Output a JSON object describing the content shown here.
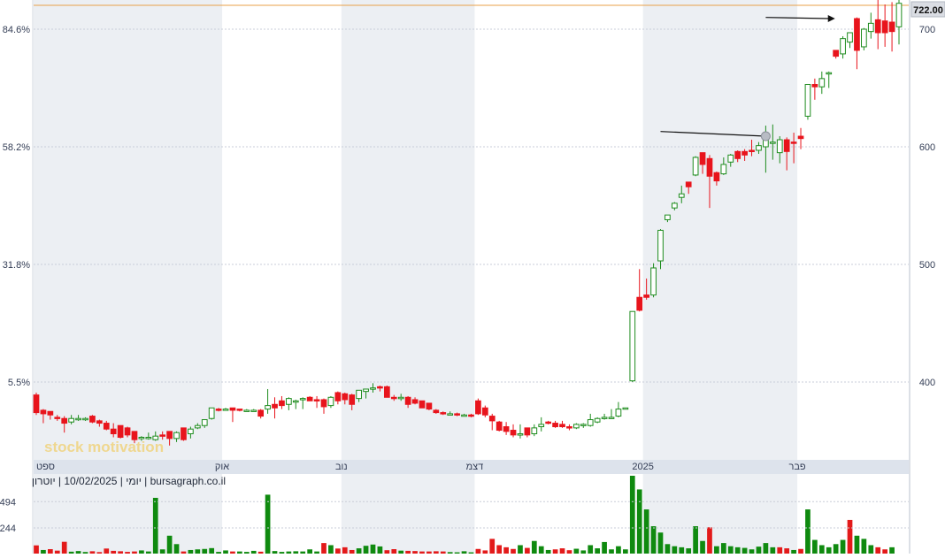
{
  "chart_data": {
    "type": "candlestick",
    "price_axis": {
      "ticks": [
        400,
        500,
        600,
        700
      ],
      "tick_labels": [
        "400",
        "500",
        "600",
        "700"
      ],
      "ylim": [
        326,
        728
      ]
    },
    "percent_axis": {
      "ticks": [
        400,
        500,
        600,
        700
      ],
      "tick_labels": [
        "5.5%",
        "31.8%",
        "58.2%",
        "84.6%"
      ]
    },
    "last_price": {
      "value": 722,
      "label": "722.00"
    },
    "month_labels": [
      {
        "index": 0,
        "label": "ספט"
      },
      {
        "index": 27,
        "label": "אוק"
      },
      {
        "index": 44,
        "label": "נוב"
      },
      {
        "index": 63,
        "label": "דצמ"
      },
      {
        "index": 87,
        "label": "2025"
      },
      {
        "index": 109,
        "label": "פבר"
      }
    ],
    "info_text": "יומי | 10/02/2025 | יוטרון | bursagraph.co.il",
    "watermark": "stock motivation",
    "volume_axis": {
      "ticks": [
        244,
        494
      ],
      "tick_labels": [
        "244",
        "494"
      ],
      "ylim": [
        0,
        740
      ]
    },
    "trendlines": [
      {
        "from": {
          "index": 89,
          "price": 613
        },
        "to": {
          "index": 104,
          "price": 609
        },
        "end_marker": "dot"
      },
      {
        "from": {
          "index": 104,
          "price": 710
        },
        "to": {
          "index": 113,
          "price": 709
        },
        "end_marker": "arrow"
      }
    ],
    "candles": [
      {
        "o": 389,
        "h": 391,
        "l": 372,
        "c": 374
      },
      {
        "o": 376,
        "h": 377,
        "l": 365,
        "c": 373
      },
      {
        "o": 375,
        "h": 375,
        "l": 368,
        "c": 372
      },
      {
        "o": 370,
        "h": 372,
        "l": 367,
        "c": 369
      },
      {
        "o": 369,
        "h": 371,
        "l": 357,
        "c": 365
      },
      {
        "o": 366,
        "h": 372,
        "l": 364,
        "c": 369
      },
      {
        "o": 368,
        "h": 372,
        "l": 367,
        "c": 369
      },
      {
        "o": 369,
        "h": 370,
        "l": 367,
        "c": 369
      },
      {
        "o": 371,
        "h": 372,
        "l": 365,
        "c": 366
      },
      {
        "o": 367,
        "h": 368,
        "l": 362,
        "c": 365
      },
      {
        "o": 365,
        "h": 367,
        "l": 359,
        "c": 360
      },
      {
        "o": 360,
        "h": 365,
        "l": 353,
        "c": 356
      },
      {
        "o": 363,
        "h": 363,
        "l": 352,
        "c": 353
      },
      {
        "o": 361,
        "h": 362,
        "l": 353,
        "c": 355
      },
      {
        "o": 358,
        "h": 358,
        "l": 348,
        "c": 351
      },
      {
        "o": 352,
        "h": 354,
        "l": 350,
        "c": 353
      },
      {
        "o": 353,
        "h": 357,
        "l": 351,
        "c": 353
      },
      {
        "o": 351,
        "h": 358,
        "l": 350,
        "c": 354
      },
      {
        "o": 355,
        "h": 358,
        "l": 351,
        "c": 354
      },
      {
        "o": 358,
        "h": 358,
        "l": 346,
        "c": 352
      },
      {
        "o": 352,
        "h": 358,
        "l": 349,
        "c": 357
      },
      {
        "o": 361,
        "h": 361,
        "l": 350,
        "c": 351
      },
      {
        "o": 356,
        "h": 362,
        "l": 352,
        "c": 360
      },
      {
        "o": 361,
        "h": 365,
        "l": 360,
        "c": 363
      },
      {
        "o": 363,
        "h": 368,
        "l": 361,
        "c": 368
      },
      {
        "o": 369,
        "h": 378,
        "l": 368,
        "c": 378
      },
      {
        "o": 377,
        "h": 378,
        "l": 375,
        "c": 376
      },
      {
        "o": 377,
        "h": 378,
        "l": 376,
        "c": 377
      },
      {
        "o": 378,
        "h": 378,
        "l": 366,
        "c": 376
      },
      {
        "o": 377,
        "h": 377,
        "l": 375,
        "c": 376
      },
      {
        "o": 376,
        "h": 377,
        "l": 375,
        "c": 376
      },
      {
        "o": 376,
        "h": 377,
        "l": 375,
        "c": 376
      },
      {
        "o": 376,
        "h": 377,
        "l": 369,
        "c": 371
      },
      {
        "o": 377,
        "h": 394,
        "l": 373,
        "c": 380
      },
      {
        "o": 381,
        "h": 387,
        "l": 369,
        "c": 378
      },
      {
        "o": 384,
        "h": 388,
        "l": 377,
        "c": 380
      },
      {
        "o": 381,
        "h": 387,
        "l": 376,
        "c": 386
      },
      {
        "o": 383,
        "h": 385,
        "l": 377,
        "c": 384
      },
      {
        "o": 385,
        "h": 387,
        "l": 377,
        "c": 386
      },
      {
        "o": 387,
        "h": 388,
        "l": 384,
        "c": 384
      },
      {
        "o": 385,
        "h": 388,
        "l": 378,
        "c": 384
      },
      {
        "o": 385,
        "h": 386,
        "l": 373,
        "c": 379
      },
      {
        "o": 380,
        "h": 388,
        "l": 378,
        "c": 387
      },
      {
        "o": 391,
        "h": 392,
        "l": 381,
        "c": 384
      },
      {
        "o": 390,
        "h": 391,
        "l": 381,
        "c": 385
      },
      {
        "o": 389,
        "h": 390,
        "l": 376,
        "c": 381
      },
      {
        "o": 386,
        "h": 392,
        "l": 383,
        "c": 393
      },
      {
        "o": 392,
        "h": 393,
        "l": 386,
        "c": 394
      },
      {
        "o": 394,
        "h": 399,
        "l": 391,
        "c": 395
      },
      {
        "o": 396,
        "h": 397,
        "l": 392,
        "c": 395
      },
      {
        "o": 396,
        "h": 397,
        "l": 387,
        "c": 387
      },
      {
        "o": 387,
        "h": 389,
        "l": 384,
        "c": 386
      },
      {
        "o": 387,
        "h": 390,
        "l": 384,
        "c": 387
      },
      {
        "o": 387,
        "h": 388,
        "l": 378,
        "c": 381
      },
      {
        "o": 385,
        "h": 387,
        "l": 381,
        "c": 382
      },
      {
        "o": 384,
        "h": 384,
        "l": 379,
        "c": 378
      },
      {
        "o": 382,
        "h": 382,
        "l": 376,
        "c": 377
      },
      {
        "o": 376,
        "h": 377,
        "l": 373,
        "c": 374
      },
      {
        "o": 374,
        "h": 375,
        "l": 372,
        "c": 373
      },
      {
        "o": 373,
        "h": 375,
        "l": 372,
        "c": 373
      },
      {
        "o": 373,
        "h": 374,
        "l": 371,
        "c": 372
      },
      {
        "o": 372,
        "h": 373,
        "l": 371,
        "c": 372
      },
      {
        "o": 372,
        "h": 373,
        "l": 370,
        "c": 371
      },
      {
        "o": 384,
        "h": 386,
        "l": 372,
        "c": 373
      },
      {
        "o": 378,
        "h": 380,
        "l": 370,
        "c": 372
      },
      {
        "o": 371,
        "h": 373,
        "l": 359,
        "c": 367
      },
      {
        "o": 366,
        "h": 367,
        "l": 358,
        "c": 359
      },
      {
        "o": 362,
        "h": 366,
        "l": 355,
        "c": 358
      },
      {
        "o": 359,
        "h": 364,
        "l": 353,
        "c": 355
      },
      {
        "o": 355,
        "h": 364,
        "l": 352,
        "c": 356
      },
      {
        "o": 361,
        "h": 361,
        "l": 353,
        "c": 355
      },
      {
        "o": 356,
        "h": 364,
        "l": 354,
        "c": 361
      },
      {
        "o": 362,
        "h": 370,
        "l": 358,
        "c": 364
      },
      {
        "o": 366,
        "h": 367,
        "l": 364,
        "c": 365
      },
      {
        "o": 365,
        "h": 367,
        "l": 361,
        "c": 362
      },
      {
        "o": 364,
        "h": 367,
        "l": 361,
        "c": 362
      },
      {
        "o": 362,
        "h": 364,
        "l": 359,
        "c": 361
      },
      {
        "o": 361,
        "h": 365,
        "l": 360,
        "c": 364
      },
      {
        "o": 363,
        "h": 365,
        "l": 361,
        "c": 364
      },
      {
        "o": 363,
        "h": 373,
        "l": 362,
        "c": 368
      },
      {
        "o": 366,
        "h": 370,
        "l": 365,
        "c": 369
      },
      {
        "o": 369,
        "h": 373,
        "l": 368,
        "c": 370
      },
      {
        "o": 370,
        "h": 377,
        "l": 369,
        "c": 370
      },
      {
        "o": 371,
        "h": 383,
        "l": 370,
        "c": 377
      },
      {
        "o": 378,
        "h": 378,
        "l": 377,
        "c": 378
      },
      {
        "o": 401,
        "h": 406,
        "l": 400,
        "c": 460
      },
      {
        "o": 472,
        "h": 496,
        "l": 460,
        "c": 461
      },
      {
        "o": 474,
        "h": 488,
        "l": 470,
        "c": 472
      },
      {
        "o": 474,
        "h": 501,
        "l": 472,
        "c": 497
      },
      {
        "o": 503,
        "h": 530,
        "l": 496,
        "c": 529
      },
      {
        "o": 538,
        "h": 542,
        "l": 536,
        "c": 542
      },
      {
        "o": 548,
        "h": 553,
        "l": 546,
        "c": 552
      },
      {
        "o": 557,
        "h": 567,
        "l": 552,
        "c": 560
      },
      {
        "o": 570,
        "h": 568,
        "l": 560,
        "c": 566
      },
      {
        "o": 576,
        "h": 592,
        "l": 575,
        "c": 591
      },
      {
        "o": 595,
        "h": 592,
        "l": 577,
        "c": 585
      },
      {
        "o": 590,
        "h": 593,
        "l": 548,
        "c": 575
      },
      {
        "o": 578,
        "h": 579,
        "l": 567,
        "c": 571
      },
      {
        "o": 577,
        "h": 591,
        "l": 576,
        "c": 585
      },
      {
        "o": 587,
        "h": 594,
        "l": 583,
        "c": 593
      },
      {
        "o": 596,
        "h": 597,
        "l": 587,
        "c": 590
      },
      {
        "o": 596,
        "h": 598,
        "l": 588,
        "c": 593
      },
      {
        "o": 597,
        "h": 606,
        "l": 592,
        "c": 596
      },
      {
        "o": 597,
        "h": 604,
        "l": 594,
        "c": 601
      },
      {
        "o": 600,
        "h": 618,
        "l": 578,
        "c": 607
      },
      {
        "o": 603,
        "h": 619,
        "l": 589,
        "c": 604
      },
      {
        "o": 595,
        "h": 609,
        "l": 586,
        "c": 606
      },
      {
        "o": 606,
        "h": 608,
        "l": 580,
        "c": 596
      },
      {
        "o": 604,
        "h": 612,
        "l": 586,
        "c": 603
      },
      {
        "o": 609,
        "h": 616,
        "l": 598,
        "c": 607
      },
      {
        "o": 626,
        "h": 635,
        "l": 623,
        "c": 653
      },
      {
        "o": 653,
        "h": 658,
        "l": 640,
        "c": 651
      },
      {
        "o": 651,
        "h": 664,
        "l": 645,
        "c": 658
      },
      {
        "o": 663,
        "h": 664,
        "l": 650,
        "c": 663
      },
      {
        "o": 682,
        "h": 678,
        "l": 675,
        "c": 677
      },
      {
        "o": 679,
        "h": 694,
        "l": 675,
        "c": 692
      },
      {
        "o": 689,
        "h": 696,
        "l": 684,
        "c": 697
      },
      {
        "o": 709,
        "h": 710,
        "l": 666,
        "c": 682
      },
      {
        "o": 685,
        "h": 701,
        "l": 682,
        "c": 700
      },
      {
        "o": 698,
        "h": 714,
        "l": 692,
        "c": 705
      },
      {
        "o": 708,
        "h": 726,
        "l": 683,
        "c": 697
      },
      {
        "o": 707,
        "h": 721,
        "l": 685,
        "c": 697
      },
      {
        "o": 706,
        "h": 723,
        "l": 681,
        "c": 698
      },
      {
        "o": 702,
        "h": 728,
        "l": 687,
        "c": 722
      }
    ],
    "volumes": [
      {
        "v": 78,
        "d": "down"
      },
      {
        "v": 34,
        "d": "up"
      },
      {
        "v": 42,
        "d": "down"
      },
      {
        "v": 28,
        "d": "down"
      },
      {
        "v": 112,
        "d": "down"
      },
      {
        "v": 18,
        "d": "up"
      },
      {
        "v": 24,
        "d": "up"
      },
      {
        "v": 15,
        "d": "up"
      },
      {
        "v": 22,
        "d": "down"
      },
      {
        "v": 14,
        "d": "down"
      },
      {
        "v": 48,
        "d": "down"
      },
      {
        "v": 26,
        "d": "down"
      },
      {
        "v": 22,
        "d": "down"
      },
      {
        "v": 16,
        "d": "down"
      },
      {
        "v": 20,
        "d": "down"
      },
      {
        "v": 30,
        "d": "up"
      },
      {
        "v": 20,
        "d": "up"
      },
      {
        "v": 530,
        "d": "up"
      },
      {
        "v": 40,
        "d": "up"
      },
      {
        "v": 170,
        "d": "up"
      },
      {
        "v": 90,
        "d": "up"
      },
      {
        "v": 20,
        "d": "down"
      },
      {
        "v": 34,
        "d": "up"
      },
      {
        "v": 40,
        "d": "up"
      },
      {
        "v": 44,
        "d": "up"
      },
      {
        "v": 52,
        "d": "up"
      },
      {
        "v": 16,
        "d": "up"
      },
      {
        "v": 30,
        "d": "up"
      },
      {
        "v": 20,
        "d": "down"
      },
      {
        "v": 20,
        "d": "up"
      },
      {
        "v": 16,
        "d": "up"
      },
      {
        "v": 26,
        "d": "up"
      },
      {
        "v": 18,
        "d": "down"
      },
      {
        "v": 560,
        "d": "up"
      },
      {
        "v": 24,
        "d": "up"
      },
      {
        "v": 16,
        "d": "up"
      },
      {
        "v": 20,
        "d": "up"
      },
      {
        "v": 22,
        "d": "up"
      },
      {
        "v": 20,
        "d": "up"
      },
      {
        "v": 40,
        "d": "up"
      },
      {
        "v": 20,
        "d": "up"
      },
      {
        "v": 100,
        "d": "down"
      },
      {
        "v": 80,
        "d": "up"
      },
      {
        "v": 48,
        "d": "down"
      },
      {
        "v": 60,
        "d": "down"
      },
      {
        "v": 34,
        "d": "down"
      },
      {
        "v": 50,
        "d": "up"
      },
      {
        "v": 74,
        "d": "up"
      },
      {
        "v": 86,
        "d": "up"
      },
      {
        "v": 68,
        "d": "up"
      },
      {
        "v": 32,
        "d": "down"
      },
      {
        "v": 42,
        "d": "down"
      },
      {
        "v": 28,
        "d": "up"
      },
      {
        "v": 26,
        "d": "down"
      },
      {
        "v": 24,
        "d": "down"
      },
      {
        "v": 20,
        "d": "down"
      },
      {
        "v": 20,
        "d": "down"
      },
      {
        "v": 22,
        "d": "down"
      },
      {
        "v": 20,
        "d": "down"
      },
      {
        "v": 14,
        "d": "up"
      },
      {
        "v": 12,
        "d": "up"
      },
      {
        "v": 22,
        "d": "up"
      },
      {
        "v": 12,
        "d": "up"
      },
      {
        "v": 44,
        "d": "down"
      },
      {
        "v": 30,
        "d": "down"
      },
      {
        "v": 140,
        "d": "down"
      },
      {
        "v": 80,
        "d": "down"
      },
      {
        "v": 60,
        "d": "down"
      },
      {
        "v": 44,
        "d": "down"
      },
      {
        "v": 80,
        "d": "up"
      },
      {
        "v": 54,
        "d": "down"
      },
      {
        "v": 120,
        "d": "up"
      },
      {
        "v": 70,
        "d": "up"
      },
      {
        "v": 34,
        "d": "up"
      },
      {
        "v": 40,
        "d": "down"
      },
      {
        "v": 50,
        "d": "down"
      },
      {
        "v": 32,
        "d": "down"
      },
      {
        "v": 46,
        "d": "up"
      },
      {
        "v": 30,
        "d": "up"
      },
      {
        "v": 80,
        "d": "up"
      },
      {
        "v": 50,
        "d": "up"
      },
      {
        "v": 110,
        "d": "up"
      },
      {
        "v": 40,
        "d": "up"
      },
      {
        "v": 70,
        "d": "up"
      },
      {
        "v": 40,
        "d": "up"
      },
      {
        "v": 740,
        "d": "up"
      },
      {
        "v": 610,
        "d": "up"
      },
      {
        "v": 420,
        "d": "up"
      },
      {
        "v": 260,
        "d": "up"
      },
      {
        "v": 200,
        "d": "up"
      },
      {
        "v": 90,
        "d": "up"
      },
      {
        "v": 70,
        "d": "up"
      },
      {
        "v": 60,
        "d": "up"
      },
      {
        "v": 50,
        "d": "up"
      },
      {
        "v": 260,
        "d": "up"
      },
      {
        "v": 120,
        "d": "up"
      },
      {
        "v": 250,
        "d": "down"
      },
      {
        "v": 70,
        "d": "up"
      },
      {
        "v": 100,
        "d": "up"
      },
      {
        "v": 70,
        "d": "up"
      },
      {
        "v": 60,
        "d": "up"
      },
      {
        "v": 54,
        "d": "up"
      },
      {
        "v": 40,
        "d": "up"
      },
      {
        "v": 66,
        "d": "up"
      },
      {
        "v": 100,
        "d": "up"
      },
      {
        "v": 60,
        "d": "up"
      },
      {
        "v": 60,
        "d": "down"
      },
      {
        "v": 50,
        "d": "down"
      },
      {
        "v": 34,
        "d": "up"
      },
      {
        "v": 44,
        "d": "down"
      },
      {
        "v": 420,
        "d": "up"
      },
      {
        "v": 130,
        "d": "up"
      },
      {
        "v": 80,
        "d": "up"
      },
      {
        "v": 60,
        "d": "up"
      },
      {
        "v": 90,
        "d": "up"
      },
      {
        "v": 130,
        "d": "up"
      },
      {
        "v": 320,
        "d": "down"
      },
      {
        "v": 170,
        "d": "up"
      },
      {
        "v": 140,
        "d": "up"
      },
      {
        "v": 80,
        "d": "up"
      },
      {
        "v": 60,
        "d": "down"
      },
      {
        "v": 40,
        "d": "down"
      },
      {
        "v": 60,
        "d": "up"
      }
    ],
    "colors": {
      "up": "#1e8c1e",
      "down": "#e8141c",
      "band": "#eceff3",
      "grid": "#c9ced8",
      "last_price_line": "#e8a04a",
      "label_strip": "#dde3ec",
      "price_box": "#dadde3",
      "volume_up": "#0f8a0f",
      "volume_down": "#e31a1a",
      "watermark": "#f2c23c"
    },
    "grid": true,
    "legend": "none"
  }
}
